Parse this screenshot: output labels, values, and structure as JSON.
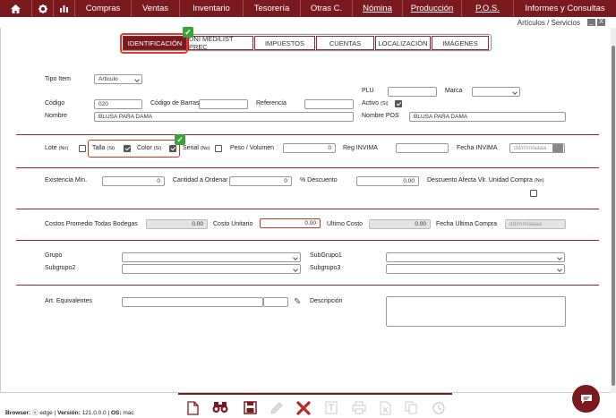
{
  "nav": {
    "home_icon": "home-icon",
    "settings_icon": "gear-icon",
    "chart_icon": "bar-chart-icon",
    "items": [
      "Compras",
      "Ventas",
      "Inventario",
      "Tesorería",
      "Otras C.",
      "Nómina",
      "Producción",
      "P.O.S.",
      "Informes y Consultas"
    ]
  },
  "window": {
    "title": "Artículos / Servicios",
    "minimize": "_",
    "close": "X"
  },
  "tabs": [
    "IDENTIFICACIÓN",
    "UNI MED/LIST PREC",
    "IMPUESTOS",
    "CUENTAS",
    "LOCALIZACIÓN",
    "IMÁGENES"
  ],
  "form": {
    "tipo_item_label": "Tipo Item",
    "tipo_item_value": "Articulo",
    "plu_label": "PLU",
    "plu_value": "",
    "marca_label": "Marca",
    "marca_value": "",
    "codigo_label": "Código",
    "codigo_value": "020",
    "codigo_barras_label": "Código de Barras",
    "codigo_barras_value": "",
    "referencia_label": "Referencia",
    "referencia_value": "",
    "activo_label": "Activo",
    "activo_hint": "(Si)",
    "nombre_label": "Nombre",
    "nombre_value": "BLUSA PARA DAMA",
    "nombre_pos_label": "Nombre POS",
    "nombre_pos_value": "BLUSA PARA DAMA",
    "lote_label": "Lote",
    "lote_hint": "(No)",
    "talla_label": "Talla",
    "talla_hint": "(Si)",
    "color_label": "Color",
    "color_hint": "(Si)",
    "serial_label": "Serial",
    "serial_hint": "(No)",
    "peso_label": "Peso / Volumen",
    "peso_value": "0",
    "reg_invima_label": "Reg INVIMA",
    "reg_invima_value": "",
    "fecha_invima_label": "Fecha INVIMA",
    "fecha_invima_placeholder": "dd/mm/aaaa",
    "existencia_label": "Existencia Min.",
    "existencia_value": "0",
    "cantidad_label": "Cantidad a Ordenar",
    "cantidad_value": "0",
    "descuento_label": "% Descuento",
    "descuento_value": "0.00",
    "desc_afecta_label": "Descuento Afecta Vlr. Unidad Compra",
    "desc_afecta_hint": "(No)",
    "costos_label": "Costos Promedio Todas Bodegas",
    "costos_value": "0.00",
    "costo_unit_label": "Costo Unitario",
    "costo_unit_value": "0.00",
    "ultimo_costo_label": "Ultimo Costo",
    "ultimo_costo_value": "0.00",
    "fecha_compra_label": "Fecha Ultima Compra",
    "fecha_compra_placeholder": "dd/mm/aaaa",
    "grupo_label": "Grupo",
    "subgrupo1_label": "SubGrupo1",
    "subgrupo2_label": "Subgrupo2",
    "subgrupo3_label": "Subgrupo3",
    "art_equiv_label": "Art. Equivalentes",
    "descripcion_label": "Descripción"
  },
  "footer": {
    "browser_label": "Browser:",
    "browser_value": "edge",
    "version_label": "Versión:",
    "version_value": "121.0.0.0",
    "os_label": "OS:",
    "os_value": "mac"
  },
  "colors": {
    "brand": "#7b1a1e",
    "highlight": "#e23a2e",
    "check": "#3aa33a"
  }
}
